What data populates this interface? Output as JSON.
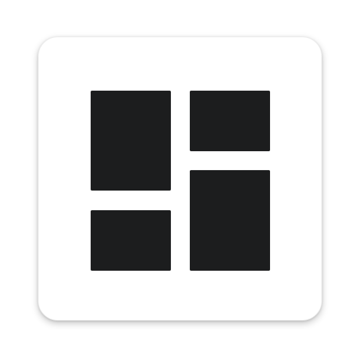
{
  "icon": {
    "name": "dashboard-layout-icon",
    "background_color": "#ffffff",
    "tile_color": "#1c1d1e"
  }
}
